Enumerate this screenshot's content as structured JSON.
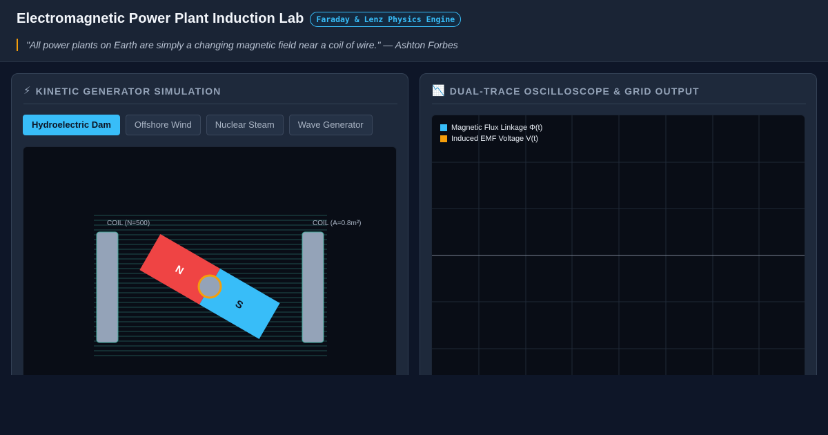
{
  "header": {
    "title": "Electromagnetic Power Plant Induction Lab",
    "badge": "Faraday & Lenz Physics Engine",
    "quote": "\"All power plants on Earth are simply a changing magnetic field near a coil of wire.\" — Ashton Forbes"
  },
  "left_panel": {
    "icon": "⚡",
    "icon_name": "lightning-bolt-icon",
    "title": "KINETIC GENERATOR SIMULATION",
    "tabs": [
      {
        "label": "Hydroelectric Dam",
        "active": true
      },
      {
        "label": "Offshore Wind",
        "active": false
      },
      {
        "label": "Nuclear Steam",
        "active": false
      },
      {
        "label": "Wave Generator",
        "active": false
      }
    ],
    "simulation": {
      "coil_left_label": "COIL (N=500)",
      "coil_right_label": "COIL (A=0.8m²)",
      "north_label": "N",
      "south_label": "S"
    }
  },
  "right_panel": {
    "icon": "📉",
    "icon_name": "chart-decreasing-icon",
    "title": "DUAL-TRACE OSCILLOSCOPE & GRID OUTPUT",
    "legend": [
      {
        "label": "Magnetic Flux Linkage Φ(t)",
        "color": "#38bdf8"
      },
      {
        "label": "Induced EMF Voltage V(t)",
        "color": "#f59e0b"
      }
    ]
  },
  "colors": {
    "accent": "#38bdf8",
    "warning": "#f59e0b",
    "north_pole": "#ef4444",
    "south_pole": "#38bdf8",
    "coil": "#94a3b8"
  }
}
